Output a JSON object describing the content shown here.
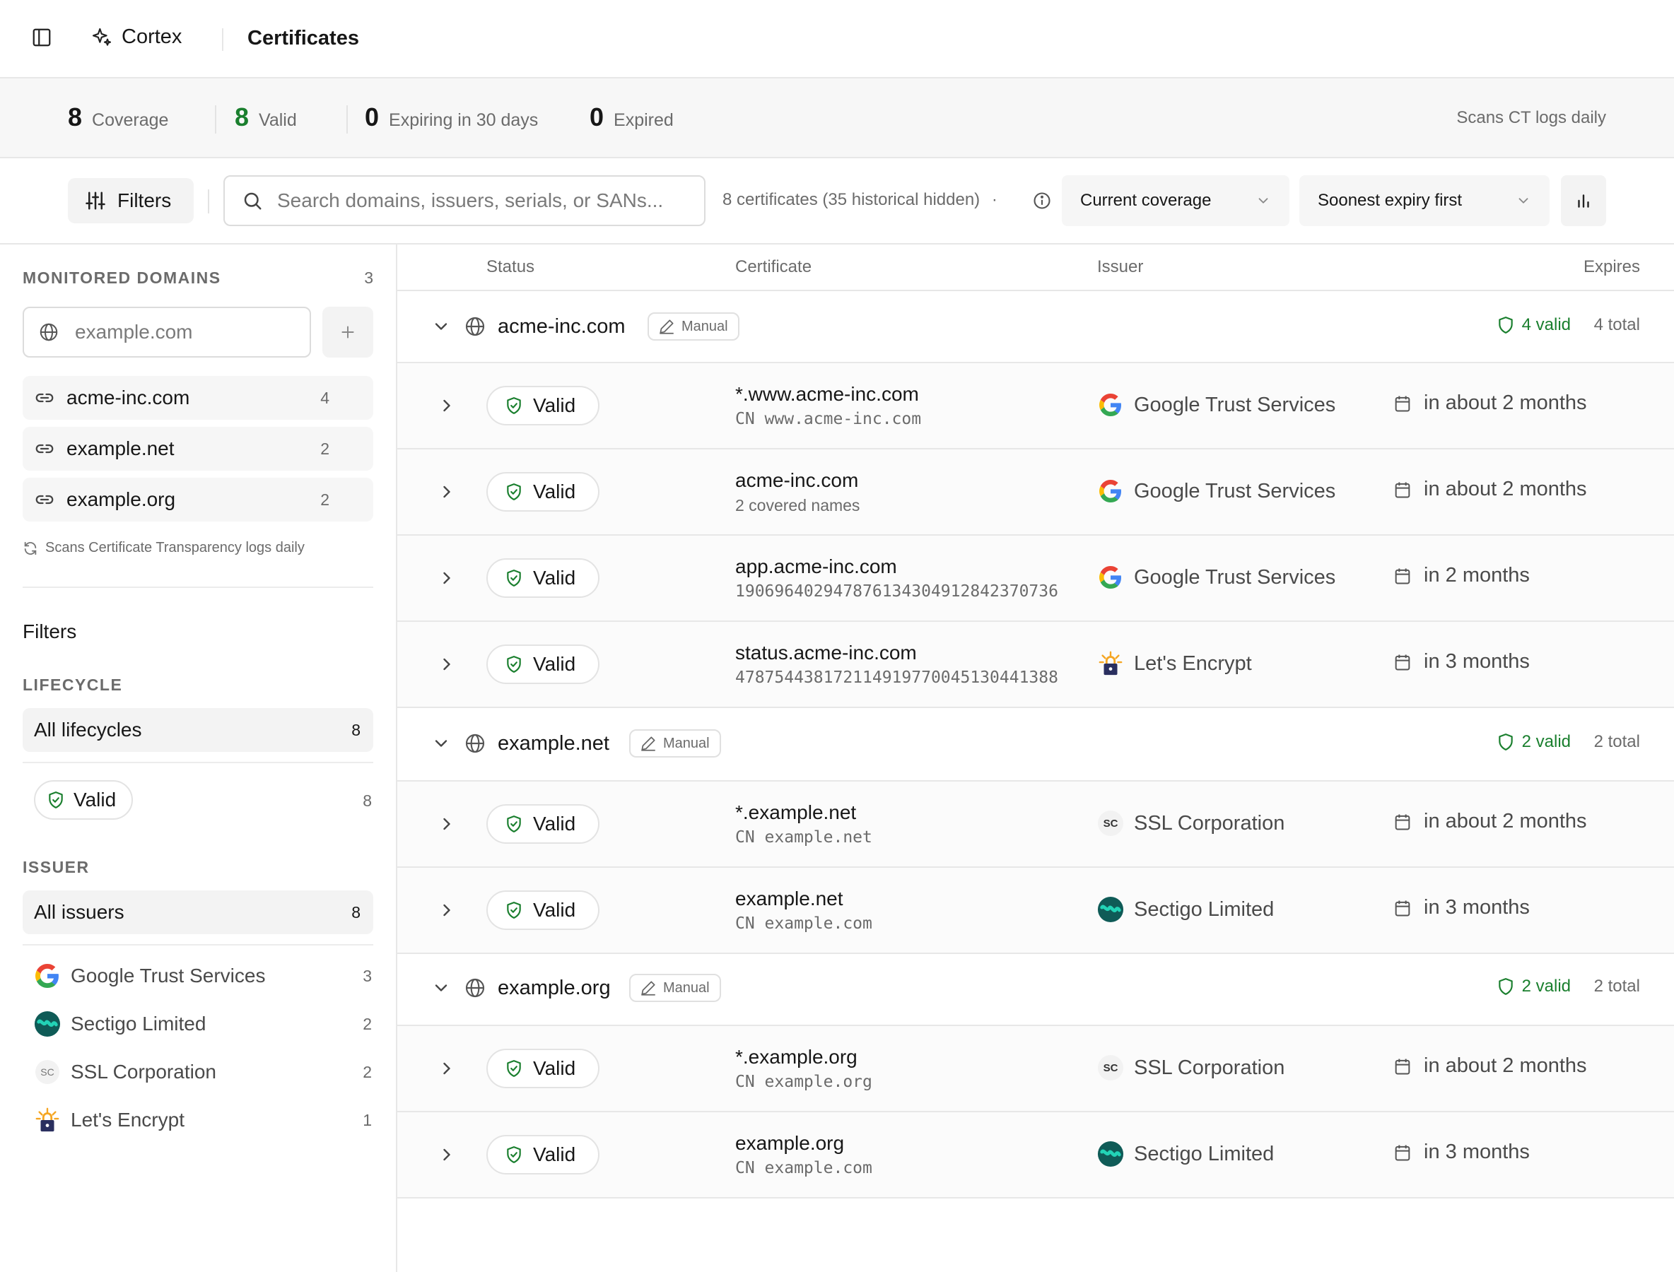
{
  "topbar": {
    "brand": "Cortex",
    "title": "Certificates"
  },
  "stats": {
    "items": [
      {
        "value": "8",
        "label": "Coverage"
      },
      {
        "value": "8",
        "label": "Valid"
      },
      {
        "value": "0",
        "label": "Expiring in 30 days"
      },
      {
        "value": "0",
        "label": "Expired"
      }
    ],
    "right_note": "Scans CT logs daily"
  },
  "toolbar": {
    "filters_label": "Filters",
    "search_placeholder": "Search domains, issuers, serials, or SANs...",
    "count_text": "8 certificates (35 historical hidden)",
    "count_dot": "·",
    "coverage_select": "Current coverage",
    "sort_select": "Soonest expiry first"
  },
  "sidebar": {
    "monitored_heading": "MONITORED DOMAINS",
    "monitored_count": "3",
    "domain_placeholder": "example.com",
    "domains": [
      {
        "name": "acme-inc.com",
        "count": "4"
      },
      {
        "name": "example.net",
        "count": "2"
      },
      {
        "name": "example.org",
        "count": "2"
      }
    ],
    "scan_note": "Scans Certificate Transparency logs daily",
    "filters_title": "Filters",
    "lifecycle_heading": "LIFECYCLE",
    "lifecycle_all": {
      "label": "All lifecycles",
      "count": "8"
    },
    "lifecycle_valid": {
      "label": "Valid",
      "count": "8"
    },
    "issuer_heading": "ISSUER",
    "issuer_all": {
      "label": "All issuers",
      "count": "8"
    },
    "issuers": [
      {
        "name": "Google Trust Services",
        "count": "3",
        "logo": "google"
      },
      {
        "name": "Sectigo Limited",
        "count": "2",
        "logo": "sectigo"
      },
      {
        "name": "SSL Corporation",
        "count": "2",
        "logo": "sc"
      },
      {
        "name": "Let's Encrypt",
        "count": "1",
        "logo": "letsencrypt"
      }
    ]
  },
  "table": {
    "headers": {
      "status": "Status",
      "certificate": "Certificate",
      "issuer": "Issuer",
      "expires": "Expires"
    },
    "groups": [
      {
        "domain": "acme-inc.com",
        "badge": "Manual",
        "valid": "4 valid",
        "total": "4 total"
      },
      {
        "domain": "example.net",
        "badge": "Manual",
        "valid": "2 valid",
        "total": "2 total"
      },
      {
        "domain": "example.org",
        "badge": "Manual",
        "valid": "2 valid",
        "total": "2 total"
      }
    ],
    "rows": [
      {
        "status": "Valid",
        "name": "*.www.acme-inc.com",
        "sub": "CN www.acme-inc.com",
        "issuer": "Google Trust Services",
        "expires": "in about 2 months"
      },
      {
        "status": "Valid",
        "name": "acme-inc.com",
        "sub": "2 covered names",
        "issuer": "Google Trust Services",
        "expires": "in about 2 months"
      },
      {
        "status": "Valid",
        "name": "app.acme-inc.com",
        "sub": "190696402947876134304912842370736",
        "issuer": "Google Trust Services",
        "expires": "in 2 months"
      },
      {
        "status": "Valid",
        "name": "status.acme-inc.com",
        "sub": "478754438172114919770045130441388",
        "issuer": "Let's Encrypt",
        "expires": "in 3 months"
      },
      {
        "status": "Valid",
        "name": "*.example.net",
        "sub": "CN example.net",
        "issuer": "SSL Corporation",
        "expires": "in about 2 months"
      },
      {
        "status": "Valid",
        "name": "example.net",
        "sub": "CN example.com",
        "issuer": "Sectigo Limited",
        "expires": "in 3 months"
      },
      {
        "status": "Valid",
        "name": "*.example.org",
        "sub": "CN example.org",
        "issuer": "SSL Corporation",
        "expires": "in about 2 months"
      },
      {
        "status": "Valid",
        "name": "example.org",
        "sub": "CN example.com",
        "issuer": "Sectigo Limited",
        "expires": "in 3 months"
      }
    ]
  },
  "colors": {
    "accent_green": "#1a7f2e",
    "border": "#e7e7e7",
    "muted": "#6b6b6b"
  },
  "icons": [
    "sidebar-toggle-icon",
    "sparkle-icon",
    "sliders-icon",
    "search-icon",
    "info-icon",
    "chevron-down-icon",
    "bar-chart-icon",
    "globe-icon",
    "plus-icon",
    "link-icon",
    "refresh-icon",
    "shield-check-icon",
    "pencil-icon",
    "chevron-right-icon",
    "calendar-icon",
    "shield-icon"
  ]
}
